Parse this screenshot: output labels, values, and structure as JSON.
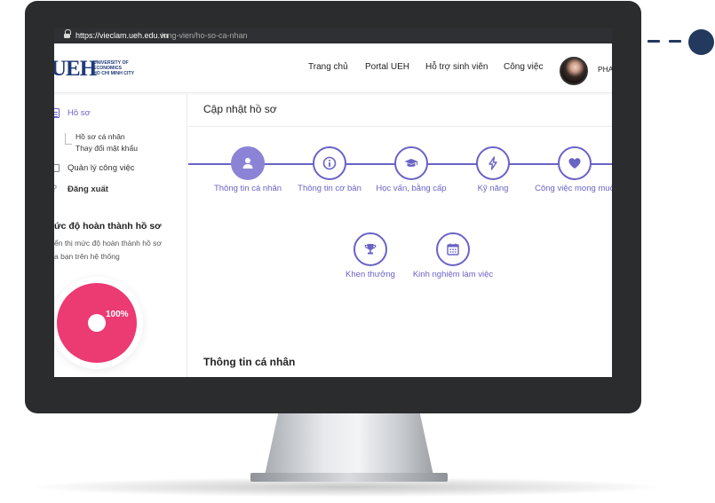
{
  "browser": {
    "url_host": "https://vieclam.ueh.edu.vn",
    "url_path": "/ung-vien/ho-so-ca-nhan"
  },
  "logo": {
    "mark": "UEH",
    "line1": "UNIVERSITY OF",
    "line2": "ECONOMICS",
    "line3": "HO CHI MINH CITY"
  },
  "nav": {
    "items": [
      "Trang chủ",
      "Portal UEH",
      "Hỗ trợ sinh viên",
      "Công việc"
    ],
    "user_name": "PHA"
  },
  "sidebar": {
    "profile": "Hồ sơ",
    "personal_profile": "Hồ sơ cá nhân",
    "change_password": "Thay đổi mật khẩu",
    "manage_jobs": "Quản lý công việc",
    "logout": "Đăng xuất",
    "completion_heading": "ức độ hoàn thành hồ sơ",
    "completion_desc_1": "ển thị mức độ hoàn thành hồ sơ",
    "completion_desc_2": "a bạn trên hệ thống",
    "completion_percent": "100%",
    "completion_value": 1.0
  },
  "main": {
    "title": "Cập nhật hồ sơ",
    "steps": [
      {
        "label": "Thông tin cá nhân",
        "icon": "person-icon",
        "active": true
      },
      {
        "label": "Thông tin cơ bản",
        "icon": "info-icon",
        "active": false
      },
      {
        "label": "Học vấn, bằng cấp",
        "icon": "graduation-cap-icon",
        "active": false
      },
      {
        "label": "Kỹ năng",
        "icon": "lightning-icon",
        "active": false
      },
      {
        "label": "Công việc mong muố",
        "icon": "heart-icon",
        "active": false
      },
      {
        "label": "Khen thưởng",
        "icon": "trophy-icon",
        "active": false
      },
      {
        "label": "Kinh nghiệm làm việc",
        "icon": "calendar-icon",
        "active": false
      }
    ],
    "section_title": "Thông tin cá nhân"
  },
  "colors": {
    "accent": "#6a63c6",
    "accent_filled": "#8b84d6",
    "progress": "#ec3a73",
    "brand": "#1f3a78",
    "bezel": "#2b2c2e",
    "decoration": "#233a5e"
  }
}
